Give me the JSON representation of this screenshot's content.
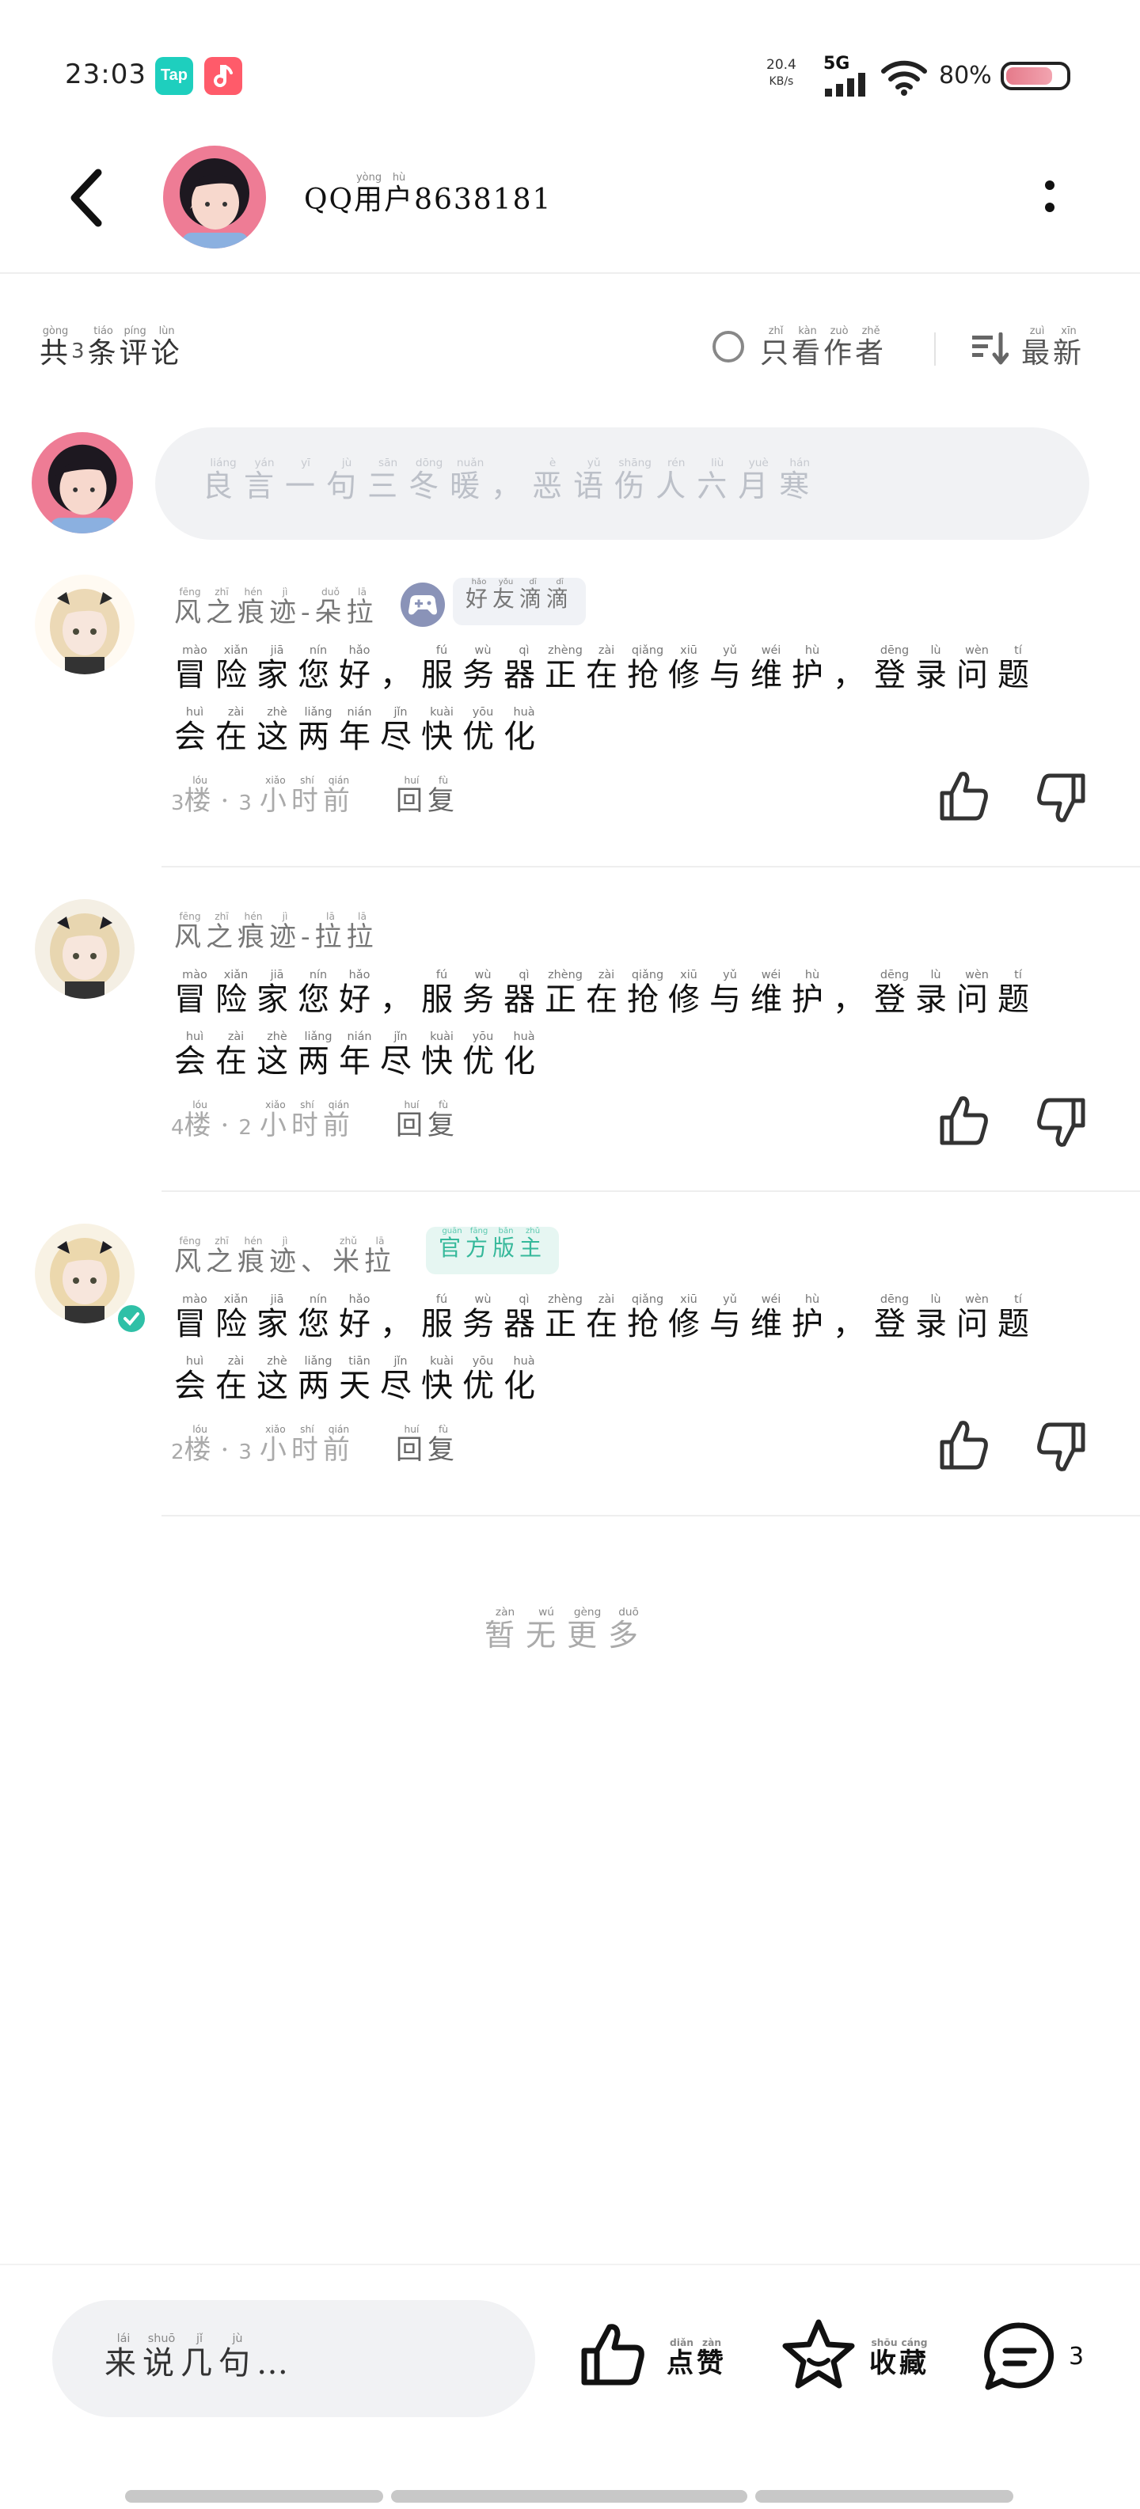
{
  "status_bar": {
    "time": "23:03",
    "apps": [
      {
        "name": "tap-icon",
        "label": "Tap",
        "color": "#1ecfbe"
      },
      {
        "name": "music-icon",
        "label": "",
        "color": "#ff5b6a"
      }
    ],
    "speed_value": "20.4",
    "speed_unit": "KB/s",
    "network": "5G",
    "battery": "80%",
    "battery_level": 0.8
  },
  "header": {
    "user_prefix": "QQ",
    "user_ruby": [
      {
        "ch": "用",
        "py": "yòng"
      },
      {
        "ch": "户",
        "py": "hù"
      }
    ],
    "user_number": "8638181"
  },
  "filters": {
    "count_pre": [
      {
        "ch": "共",
        "py": "gòng"
      }
    ],
    "count_value": "3",
    "count_post": [
      {
        "ch": "条",
        "py": "tiáo"
      },
      {
        "ch": "评",
        "py": "píng"
      },
      {
        "ch": "论",
        "py": "lùn"
      }
    ],
    "only_author": [
      {
        "ch": "只",
        "py": "zhǐ"
      },
      {
        "ch": "看",
        "py": "kàn"
      },
      {
        "ch": "作",
        "py": "zuò"
      },
      {
        "ch": "者",
        "py": "zhě"
      }
    ],
    "sort": [
      {
        "ch": "最",
        "py": "zuì"
      },
      {
        "ch": "新",
        "py": "xīn"
      }
    ]
  },
  "comment_input": {
    "placeholder": [
      {
        "ch": "良",
        "py": "liáng"
      },
      {
        "ch": "言",
        "py": "yán"
      },
      {
        "ch": "一",
        "py": "yī"
      },
      {
        "ch": "句",
        "py": "jù"
      },
      {
        "ch": "三",
        "py": "sān"
      },
      {
        "ch": "冬",
        "py": "dōng"
      },
      {
        "ch": "暖",
        "py": "nuǎn"
      },
      {
        "ch": "，",
        "py": ""
      },
      {
        "ch": "恶",
        "py": "è"
      },
      {
        "ch": "语",
        "py": "yǔ"
      },
      {
        "ch": "伤",
        "py": "shāng"
      },
      {
        "ch": "人",
        "py": "rén"
      },
      {
        "ch": "六",
        "py": "liù"
      },
      {
        "ch": "月",
        "py": "yuè"
      },
      {
        "ch": "寒",
        "py": "hán"
      }
    ]
  },
  "comments": [
    {
      "name": [
        {
          "ch": "风",
          "py": "fēng"
        },
        {
          "ch": "之",
          "py": "zhī"
        },
        {
          "ch": "痕",
          "py": "hén"
        },
        {
          "ch": "迹",
          "py": "jì"
        },
        {
          "ch": "-",
          "py": ""
        },
        {
          "ch": "朵",
          "py": "duǒ"
        },
        {
          "ch": "拉",
          "py": "lā"
        }
      ],
      "has_game_badge": true,
      "tag": [
        {
          "ch": "好",
          "py": "hǎo"
        },
        {
          "ch": "友",
          "py": "yǒu"
        },
        {
          "ch": "滴",
          "py": "dī"
        },
        {
          "ch": "滴",
          "py": "dī"
        }
      ],
      "tag_type": "friend",
      "line1": [
        {
          "ch": "冒",
          "py": "mào"
        },
        {
          "ch": "险",
          "py": "xiǎn"
        },
        {
          "ch": "家",
          "py": "jiā"
        },
        {
          "ch": "您",
          "py": "nín"
        },
        {
          "ch": "好",
          "py": "hǎo"
        },
        {
          "ch": "，",
          "py": ""
        },
        {
          "ch": "服",
          "py": "fú"
        },
        {
          "ch": "务",
          "py": "wù"
        },
        {
          "ch": "器",
          "py": "qì"
        },
        {
          "ch": "正",
          "py": "zhèng"
        },
        {
          "ch": "在",
          "py": "zài"
        },
        {
          "ch": "抢",
          "py": "qiǎng"
        },
        {
          "ch": "修",
          "py": "xiū"
        },
        {
          "ch": "与",
          "py": "yǔ"
        },
        {
          "ch": "维",
          "py": "wéi"
        },
        {
          "ch": "护",
          "py": "hù"
        },
        {
          "ch": "，",
          "py": ""
        },
        {
          "ch": "登",
          "py": "dēng"
        },
        {
          "ch": "录",
          "py": "lù"
        },
        {
          "ch": "问",
          "py": "wèn"
        },
        {
          "ch": "题",
          "py": "tí"
        }
      ],
      "line2": [
        {
          "ch": "会",
          "py": "huì"
        },
        {
          "ch": "在",
          "py": "zài"
        },
        {
          "ch": "这",
          "py": "zhè"
        },
        {
          "ch": "两",
          "py": "liǎng"
        },
        {
          "ch": "年",
          "py": "nián"
        },
        {
          "ch": "尽",
          "py": "jǐn"
        },
        {
          "ch": "快",
          "py": "kuài"
        },
        {
          "ch": "优",
          "py": "yōu"
        },
        {
          "ch": "化",
          "py": "huà"
        }
      ],
      "floor_num": "3",
      "hours_num": "3"
    },
    {
      "name": [
        {
          "ch": "风",
          "py": "fēng"
        },
        {
          "ch": "之",
          "py": "zhī"
        },
        {
          "ch": "痕",
          "py": "hén"
        },
        {
          "ch": "迹",
          "py": "jì"
        },
        {
          "ch": "-",
          "py": ""
        },
        {
          "ch": "拉",
          "py": "lā"
        },
        {
          "ch": "拉",
          "py": "lā"
        }
      ],
      "has_game_badge": false,
      "tag": [],
      "tag_type": "",
      "line1": [
        {
          "ch": "冒",
          "py": "mào"
        },
        {
          "ch": "险",
          "py": "xiǎn"
        },
        {
          "ch": "家",
          "py": "jiā"
        },
        {
          "ch": "您",
          "py": "nín"
        },
        {
          "ch": "好",
          "py": "hǎo"
        },
        {
          "ch": "，",
          "py": ""
        },
        {
          "ch": "服",
          "py": "fú"
        },
        {
          "ch": "务",
          "py": "wù"
        },
        {
          "ch": "器",
          "py": "qì"
        },
        {
          "ch": "正",
          "py": "zhèng"
        },
        {
          "ch": "在",
          "py": "zài"
        },
        {
          "ch": "抢",
          "py": "qiǎng"
        },
        {
          "ch": "修",
          "py": "xiū"
        },
        {
          "ch": "与",
          "py": "yǔ"
        },
        {
          "ch": "维",
          "py": "wéi"
        },
        {
          "ch": "护",
          "py": "hù"
        },
        {
          "ch": "，",
          "py": ""
        },
        {
          "ch": "登",
          "py": "dēng"
        },
        {
          "ch": "录",
          "py": "lù"
        },
        {
          "ch": "问",
          "py": "wèn"
        },
        {
          "ch": "题",
          "py": "tí"
        }
      ],
      "line2": [
        {
          "ch": "会",
          "py": "huì"
        },
        {
          "ch": "在",
          "py": "zài"
        },
        {
          "ch": "这",
          "py": "zhè"
        },
        {
          "ch": "两",
          "py": "liǎng"
        },
        {
          "ch": "年",
          "py": "nián"
        },
        {
          "ch": "尽",
          "py": "jǐn"
        },
        {
          "ch": "快",
          "py": "kuài"
        },
        {
          "ch": "优",
          "py": "yōu"
        },
        {
          "ch": "化",
          "py": "huà"
        }
      ],
      "floor_num": "4",
      "hours_num": "2"
    },
    {
      "name": [
        {
          "ch": "风",
          "py": "fēng"
        },
        {
          "ch": "之",
          "py": "zhī"
        },
        {
          "ch": "痕",
          "py": "hén"
        },
        {
          "ch": "迹",
          "py": "jì"
        },
        {
          "ch": "、",
          "py": ""
        },
        {
          "ch": "米",
          "py": "zhǔ"
        },
        {
          "ch": "拉",
          "py": "lā"
        }
      ],
      "has_game_badge": false,
      "tag": [
        {
          "ch": "官",
          "py": "guān"
        },
        {
          "ch": "方",
          "py": "fāng"
        },
        {
          "ch": "版",
          "py": "bǎn"
        },
        {
          "ch": "主",
          "py": "zhǔ"
        }
      ],
      "tag_type": "official",
      "line1": [
        {
          "ch": "冒",
          "py": "mào"
        },
        {
          "ch": "险",
          "py": "xiǎn"
        },
        {
          "ch": "家",
          "py": "jiā"
        },
        {
          "ch": "您",
          "py": "nín"
        },
        {
          "ch": "好",
          "py": "hǎo"
        },
        {
          "ch": "，",
          "py": ""
        },
        {
          "ch": "服",
          "py": "fú"
        },
        {
          "ch": "务",
          "py": "wù"
        },
        {
          "ch": "器",
          "py": "qì"
        },
        {
          "ch": "正",
          "py": "zhèng"
        },
        {
          "ch": "在",
          "py": "zài"
        },
        {
          "ch": "抢",
          "py": "qiǎng"
        },
        {
          "ch": "修",
          "py": "xiū"
        },
        {
          "ch": "与",
          "py": "yǔ"
        },
        {
          "ch": "维",
          "py": "wéi"
        },
        {
          "ch": "护",
          "py": "hù"
        },
        {
          "ch": "，",
          "py": ""
        },
        {
          "ch": "登",
          "py": "dēng"
        },
        {
          "ch": "录",
          "py": "lù"
        },
        {
          "ch": "问",
          "py": "wèn"
        },
        {
          "ch": "题",
          "py": "tí"
        }
      ],
      "line2": [
        {
          "ch": "会",
          "py": "huì"
        },
        {
          "ch": "在",
          "py": "zài"
        },
        {
          "ch": "这",
          "py": "zhè"
        },
        {
          "ch": "两",
          "py": "liǎng"
        },
        {
          "ch": "天",
          "py": "tiān"
        },
        {
          "ch": "尽",
          "py": "jǐn"
        },
        {
          "ch": "快",
          "py": "kuài"
        },
        {
          "ch": "优",
          "py": "yōu"
        },
        {
          "ch": "化",
          "py": "huà"
        }
      ],
      "floor_num": "2",
      "hours_num": "3"
    }
  ],
  "meta_words": {
    "floor": [
      {
        "ch": "楼",
        "py": "lóu"
      }
    ],
    "dot": "·",
    "hours": [
      {
        "ch": "小",
        "py": "xiǎo"
      },
      {
        "ch": "时",
        "py": "shí"
      },
      {
        "ch": "前",
        "py": "qián"
      }
    ],
    "reply": [
      {
        "ch": "回",
        "py": "huí"
      },
      {
        "ch": "复",
        "py": "fù"
      }
    ]
  },
  "no_more": [
    {
      "ch": "暂",
      "py": "zàn"
    },
    {
      "ch": "无",
      "py": "wú"
    },
    {
      "ch": "更",
      "py": "gèng"
    },
    {
      "ch": "多",
      "py": "duō"
    }
  ],
  "bottom_bar": {
    "say_placeholder": [
      {
        "ch": "来",
        "py": "lái"
      },
      {
        "ch": "说",
        "py": "shuō"
      },
      {
        "ch": "几",
        "py": "jǐ"
      },
      {
        "ch": "句",
        "py": "jù"
      }
    ],
    "say_suffix": "…",
    "like_label": [
      {
        "ch": "点",
        "py": "diǎn"
      },
      {
        "ch": "赞",
        "py": "zàn"
      }
    ],
    "fav_label": [
      {
        "ch": "收",
        "py": "shōu"
      },
      {
        "ch": "藏",
        "py": "cáng"
      }
    ],
    "comment_count": "3"
  },
  "colors": {
    "official_tag": "#35b89a",
    "verified_badge": "#2fc0a7",
    "accent_avatar_bg": "#ee7c95"
  }
}
